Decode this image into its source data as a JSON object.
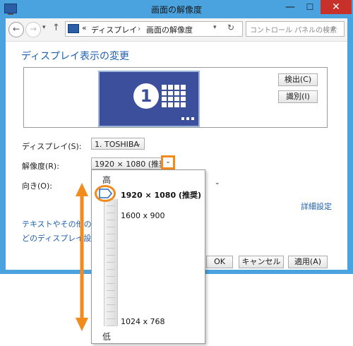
{
  "window": {
    "title": "画面の解像度"
  },
  "title_buttons": {
    "minimize": "—",
    "maximize": "☐",
    "close": "✕"
  },
  "navbar": {
    "back_icon": "back-arrow-icon",
    "forward_icon": "forward-arrow-icon",
    "up_icon": "up-arrow-icon",
    "breadcrumb_prefix": "«",
    "breadcrumb": [
      "ディスプレイ",
      "画面の解像度"
    ],
    "breadcrumb_sep": "›",
    "search_placeholder": "コントロール パネルの検索"
  },
  "heading": "ディスプレイ表示の変更",
  "preview": {
    "monitor_number": "1",
    "detect_label": "検出(C)",
    "identify_label": "識別(I)"
  },
  "form": {
    "display_label": "ディスプレイ(S):",
    "display_value": "1. TOSHIBA",
    "resolution_label": "解像度(R):",
    "resolution_value": "1920 × 1080 (推奨)",
    "orientation_label": "向き(O):"
  },
  "links": {
    "advanced": "詳細設定",
    "text_size": "テキストやその他の項目の",
    "display_settings": "どのディスプレイ設定を選択"
  },
  "buttons": {
    "ok": "OK",
    "cancel": "キャンセル",
    "apply": "適用(A)"
  },
  "resolution_slider": {
    "high_label": "高",
    "low_label": "低",
    "options": [
      "1920 × 1080 (推奨)",
      "1600 x 900",
      "1024 x 768"
    ],
    "selected": "1920 × 1080 (推奨)"
  },
  "annotation_color": "#f28a1c",
  "accent_link_color": "#1e5fb0"
}
